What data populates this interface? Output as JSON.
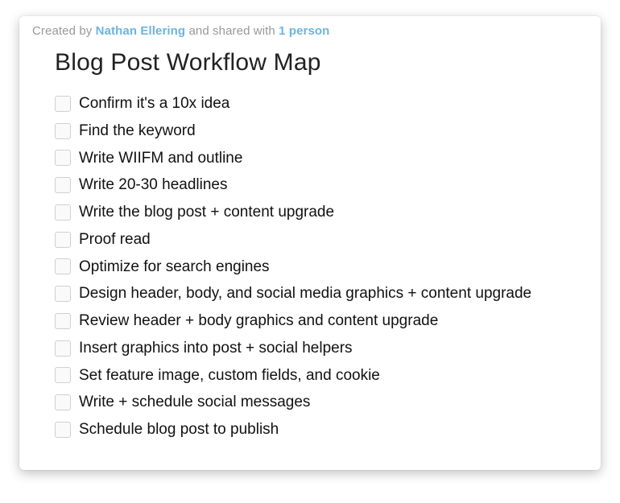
{
  "meta": {
    "prefix": "Created by ",
    "author": "Nathan Ellering",
    "middle": " and shared with ",
    "shared": "1 person"
  },
  "title": "Blog Post Workflow Map",
  "items": [
    "Confirm it's a 10x idea",
    "Find the keyword",
    "Write WIIFM and outline",
    "Write 20-30 headlines",
    "Write the blog post + content upgrade",
    "Proof read",
    "Optimize for search engines",
    "Design header, body, and social media graphics + content upgrade",
    "Review header + body graphics and content upgrade",
    "Insert graphics into post + social helpers",
    "Set feature image, custom fields, and cookie",
    "Write + schedule social messages",
    "Schedule blog post to publish"
  ]
}
